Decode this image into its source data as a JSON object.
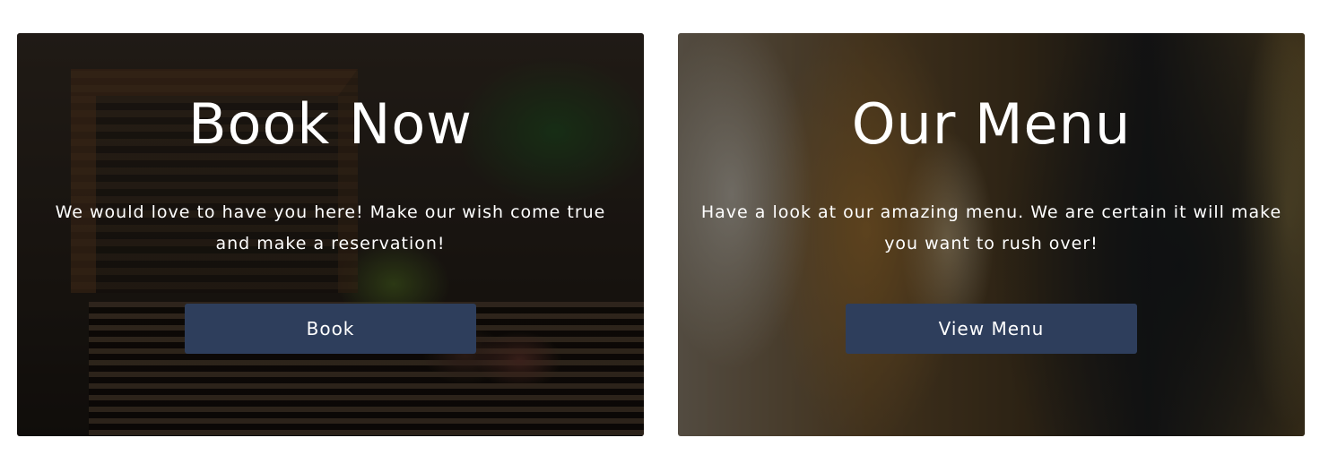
{
  "cards": [
    {
      "id": "book",
      "title": "Book Now",
      "description": "We would love to have you here! Make our wish come true and make a reservation!",
      "button_label": "Book"
    },
    {
      "id": "menu",
      "title": "Our Menu",
      "description": "Have a look at our amazing menu. We are certain it will make you want to rush over!",
      "button_label": "View Menu"
    }
  ],
  "colors": {
    "button_bg": "#2e3e5c",
    "text": "#ffffff",
    "page_bg": "#ffffff"
  }
}
